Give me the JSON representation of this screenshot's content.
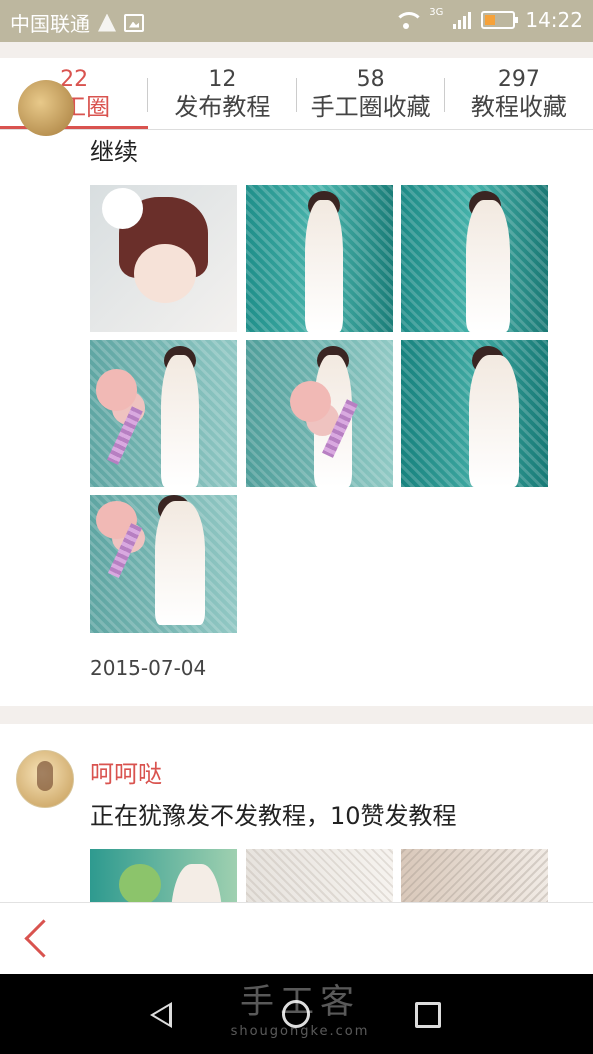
{
  "status_bar": {
    "carrier": "中国联通",
    "network": "3G",
    "time": "14:22",
    "battery_color": "#f6a23a"
  },
  "tabs": [
    {
      "count": "22",
      "label": "手工圈",
      "active": true
    },
    {
      "count": "12",
      "label": "发布教程",
      "active": false
    },
    {
      "count": "58",
      "label": "手工圈收藏",
      "active": false
    },
    {
      "count": "297",
      "label": "教程收藏",
      "active": false
    }
  ],
  "post1": {
    "text": "继续",
    "date": "2015-07-04",
    "photos": [
      "doll-portrait",
      "wedding-dress-front",
      "wedding-dress-side",
      "dress-with-flowers",
      "dress-with-rose",
      "dress-veil",
      "dress-with-lavender"
    ]
  },
  "post2": {
    "username": "呵呵哒",
    "text": "正在犹豫发不发教程，10赞发教程",
    "photos": [
      "lace-flowers",
      "lace-detail",
      "lace-hands"
    ]
  },
  "bottom_bar": {
    "back_icon": "chevron-left-icon"
  },
  "watermark": {
    "title": "手工客",
    "site": "shougongke.com"
  },
  "colors": {
    "accent": "#d9534f",
    "status_bar": "#bdb79f",
    "background": "#f3efec"
  }
}
